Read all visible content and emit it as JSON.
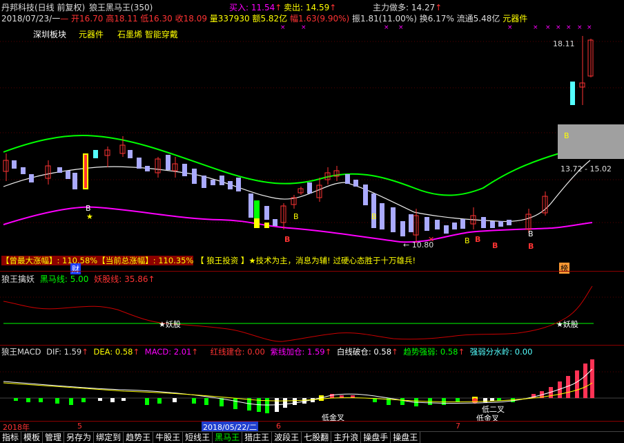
{
  "header": {
    "stock": "丹邦科技(日线 前复权)",
    "indicator": "狼王黑马王(350)",
    "buy_label": "买入:",
    "buy_value": "11.54",
    "sell_label": "卖出:",
    "sell_value": "14.59",
    "main_force_label": "主力做多:",
    "main_force_value": "14.27",
    "date": "2018/07/23/一",
    "open": "开16.70",
    "high": "高18.11",
    "low": "低16.30",
    "close": "收18.09",
    "volume": "量337930",
    "amount": "额5.82亿",
    "change": "幅1.63(9.90%)",
    "amplitude": "振1.81(11.00%)",
    "turnover": "换6.17%",
    "float_cap": "流通5.48亿",
    "sector": "元器件"
  },
  "tags": [
    "深圳板块",
    "元器件",
    "石墨烯 智能穿戴"
  ],
  "price_labels": {
    "top": "18.11",
    "range": "13.72 - 15.02",
    "low": "← 10.80"
  },
  "banner": {
    "max_gain": "【曾最大涨幅】: 110.58%",
    "current_gain": "【当前总涨幅】: 110.35%",
    "brand": "【 狼王投资 】",
    "slogan": "★技术为主，消息为辅! 过硬心态胜于十万雄兵!",
    "cai": "财",
    "bang": "榜"
  },
  "pane2": {
    "title": "狼王擒妖",
    "horse_label": "黑马线: 5.00",
    "demon_label": "妖股线: 35.86",
    "marker": "★妖股"
  },
  "pane3": {
    "title": "狼王MACD",
    "dif": "DIF: 1.59",
    "dea": "DEA: 0.58",
    "macd": "MACD: 2.01",
    "red_build": "红线建仓: 0.00",
    "purple_add": "紫线加仓: 1.59",
    "white_break": "白线破仓: 0.58",
    "trend": "趋势强弱: 0.58",
    "divide": "强弱分水岭: 0.00",
    "low_gold_1": "低金叉",
    "low_gold_2": "低二叉",
    "low_gold_3": "低金叉"
  },
  "timeline": {
    "year": "2018年",
    "m5": "5",
    "selected": "2018/05/22/二",
    "m6": "6",
    "m7": "7"
  },
  "toolbar": [
    "指标",
    "模板",
    "管理",
    "另存为",
    "绑定到",
    "趋势王",
    "牛股王",
    "短线王",
    "黑马王",
    "猎庄王",
    "波段王",
    "七股翻",
    "主升浪",
    "操盘手",
    "操盘王"
  ],
  "colors": {
    "up": "#ff3333",
    "down": "#54ffff",
    "green_line": "#00ff00",
    "magenta_line": "#ff00ff",
    "yellow": "#ffff00",
    "dark_red": "#8b0000"
  }
}
